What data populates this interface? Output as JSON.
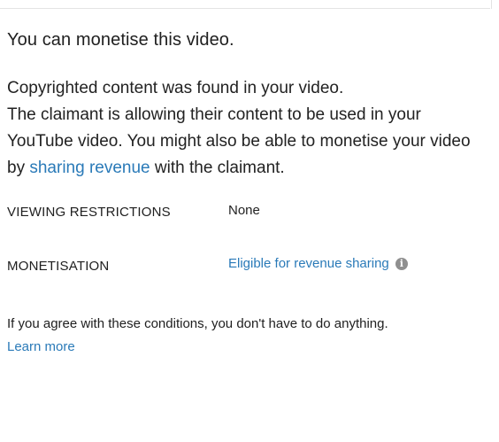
{
  "dialog": {
    "title": "You can monetise this video.",
    "body": {
      "line1": "Copyrighted content was found in your video.",
      "line2": "The claimant is allowing their content to be used in your",
      "line3": "YouTube video. You might also be able to monetise your video",
      "line4_prefix": "by ",
      "line4_link": "sharing revenue",
      "line4_suffix": " with the claimant."
    },
    "rows": [
      {
        "label": "VIEWING RESTRICTIONS",
        "value": "None"
      },
      {
        "label": "MONETISATION",
        "value": "Eligible for revenue sharing",
        "icon": "info-icon"
      }
    ],
    "note": "If you agree with these conditions, you don't have to do anything.",
    "learn_more": "Learn more",
    "colors": {
      "link": "#2a7ab8",
      "text": "#202020",
      "icon": "#8f8f8f"
    }
  }
}
